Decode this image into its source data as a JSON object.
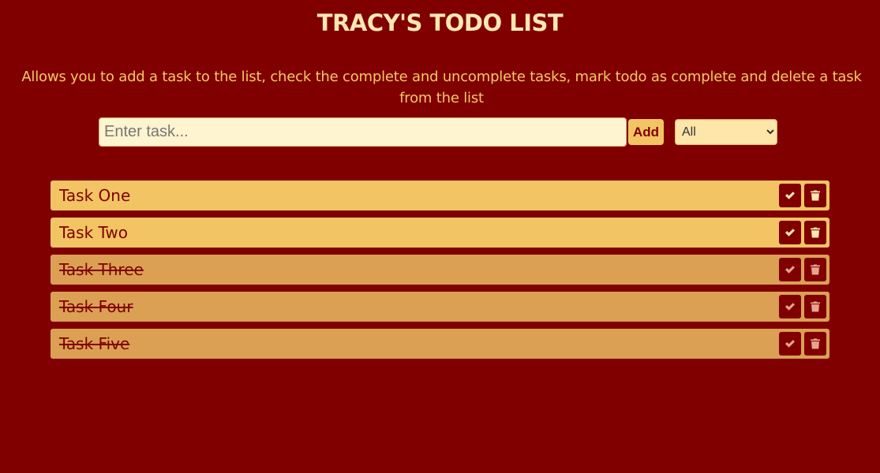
{
  "header": {
    "title": "TRACY'S TODO LIST",
    "subtitle": "Allows you to add a task to the list, check the complete and uncomplete tasks, mark todo as complete and delete a task from the list"
  },
  "form": {
    "input_placeholder": "Enter task...",
    "input_value": "",
    "add_label": "Add",
    "filter_selected": "All"
  },
  "todos": [
    {
      "text": "Task One",
      "completed": false
    },
    {
      "text": "Task Two",
      "completed": false
    },
    {
      "text": "Task Three",
      "completed": true
    },
    {
      "text": "Task Four",
      "completed": true
    },
    {
      "text": "Task Five",
      "completed": true
    }
  ],
  "icons": {
    "complete": "check-icon",
    "delete": "trash-icon"
  },
  "colors": {
    "background": "#800000",
    "title": "#fde7b3",
    "subtitle": "#f4c867",
    "item_active": "#f2c464",
    "item_completed": "#dba054",
    "button_dark": "#800000"
  }
}
